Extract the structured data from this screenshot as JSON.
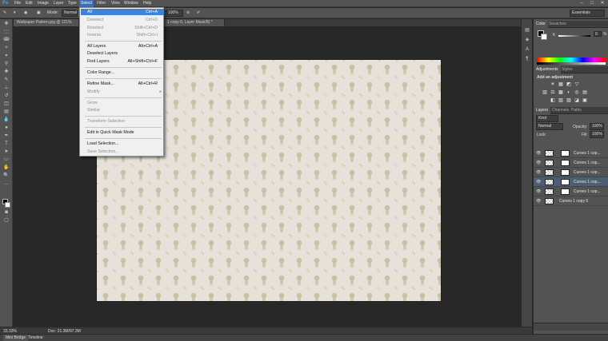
{
  "app": {
    "logo": "Ps",
    "menus": [
      "File",
      "Edit",
      "Image",
      "Layer",
      "Type",
      "Select",
      "Filter",
      "View",
      "Window",
      "Help"
    ],
    "window_controls": [
      "–",
      "□",
      "✕"
    ]
  },
  "options_bar": {
    "mode_label": "Mode:",
    "mode_value": "Normal",
    "zoom_value": "100%",
    "workspace": "Essentials"
  },
  "tabs": [
    {
      "label": "Wallpaper Pattern.jpg @ 121% (Lay"
    },
    {
      "label": "1 copy 6, Layer Mask/8) *"
    }
  ],
  "select_menu": {
    "items": [
      {
        "label": "All",
        "shortcut": "Ctrl+A",
        "state": "highlighted"
      },
      {
        "label": "Deselect",
        "shortcut": "Ctrl+D",
        "state": "disabled"
      },
      {
        "label": "Reselect",
        "shortcut": "Shift+Ctrl+D",
        "state": "disabled"
      },
      {
        "label": "Inverse",
        "shortcut": "Shift+Ctrl+I",
        "state": "disabled"
      },
      {
        "label": "All Layers",
        "shortcut": "Alt+Ctrl+A",
        "state": "enabled"
      },
      {
        "label": "Deselect Layers",
        "shortcut": "",
        "state": "enabled"
      },
      {
        "label": "Find Layers",
        "shortcut": "Alt+Shift+Ctrl+F",
        "state": "enabled"
      },
      {
        "label": "Color Range...",
        "shortcut": "",
        "state": "enabled"
      },
      {
        "label": "Refine Mask...",
        "shortcut": "Alt+Ctrl+R",
        "state": "enabled"
      },
      {
        "label": "Modify",
        "shortcut": "",
        "state": "disabled",
        "submenu": "▸"
      },
      {
        "label": "Grow",
        "shortcut": "",
        "state": "disabled"
      },
      {
        "label": "Similar",
        "shortcut": "",
        "state": "disabled"
      },
      {
        "label": "Transform Selection",
        "shortcut": "",
        "state": "disabled"
      },
      {
        "label": "Edit in Quick Mask Mode",
        "shortcut": "",
        "state": "enabled"
      },
      {
        "label": "Load Selection...",
        "shortcut": "",
        "state": "enabled"
      },
      {
        "label": "Save Selection...",
        "shortcut": "",
        "state": "disabled"
      }
    ]
  },
  "status": {
    "zoom": "33.33%",
    "doc": "Doc: 21.3M/97.3M"
  },
  "bottom_tabs": [
    "Mini Bridge",
    "Timeline"
  ],
  "color_panel": {
    "tabs": [
      "Color",
      "Swatches"
    ],
    "k_label": "K",
    "k_value": "0",
    "k_unit": "%"
  },
  "adjustments_panel": {
    "tabs": [
      "Adjustments",
      "Styles"
    ],
    "heading": "Add an adjustment",
    "icons_row1": [
      "☀",
      "▦",
      "◩",
      "▽"
    ],
    "icons_row2": [
      "▥",
      "⚖",
      "▩",
      "◐",
      "◎",
      "▤"
    ],
    "icons_row3": [
      "◧",
      "▧",
      "▨",
      "◪",
      "▣"
    ]
  },
  "layers_panel": {
    "tabs": [
      "Layers",
      "Channels",
      "Paths"
    ],
    "kind": "Kind",
    "blend_mode": "Normal",
    "opacity_label": "Opacity:",
    "opacity_value": "100%",
    "lock_label": "Lock:",
    "fill_label": "Fill:",
    "fill_value": "100%",
    "layers": [
      {
        "name": "Curves 1 cop...",
        "selected": false
      },
      {
        "name": "Curves 1 cop...",
        "selected": false
      },
      {
        "name": "Curves 1 cop...",
        "selected": false
      },
      {
        "name": "Curves 1 cop...",
        "selected": true
      },
      {
        "name": "Curves 1 cop...",
        "selected": false
      },
      {
        "name": "Curves 1 copy 6",
        "selected": false
      }
    ]
  },
  "colors": {
    "menu_highlight": "#3d84d6",
    "active_menu": "#3b6fb6",
    "ui_gray": "#535353",
    "canvas_bg": "#282828",
    "document_bg": "#e6e2da"
  }
}
